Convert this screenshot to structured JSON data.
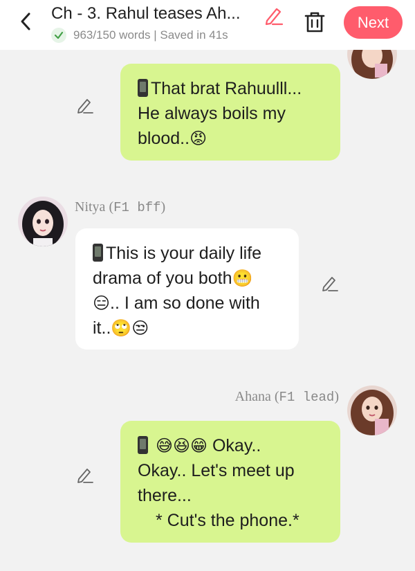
{
  "header": {
    "title": "Ch - 3. Rahul teases Ah...",
    "status": "963/150 words | Saved in 41s",
    "next_label": "Next",
    "accent": "#ff5c6c"
  },
  "icons": [
    "back-arrow-icon",
    "pencil-icon",
    "trash-icon",
    "check-icon",
    "phone-icon"
  ],
  "messages": [
    {
      "line1": "That brat Rahuulll...",
      "line2": "He always boils my",
      "line3": "blood..",
      "emoji3": "😡"
    },
    {
      "sender": "Nitya",
      "role_open": "(",
      "role": "F1 bff",
      "role_close": ")",
      "line1": "This is your daily life",
      "line2": "drama of you both",
      "emoji2": "😬",
      "emoji3a": "😑",
      "line3": ".. I am so done with",
      "line4": "it..",
      "emoji4": "🙄😒"
    },
    {
      "sender": "Ahana",
      "role_open": "(",
      "role": "F1 lead",
      "role_close": ")",
      "emoji1": "😅😆😁",
      "line1": "Okay..",
      "line2": "Okay.. Let's meet up",
      "line3": "there...",
      "line4": "* Cut's the phone.*"
    }
  ],
  "colors": {
    "green_bubble": "#d8f590",
    "white_bubble": "#ffffff",
    "background": "#f2f2f2"
  }
}
